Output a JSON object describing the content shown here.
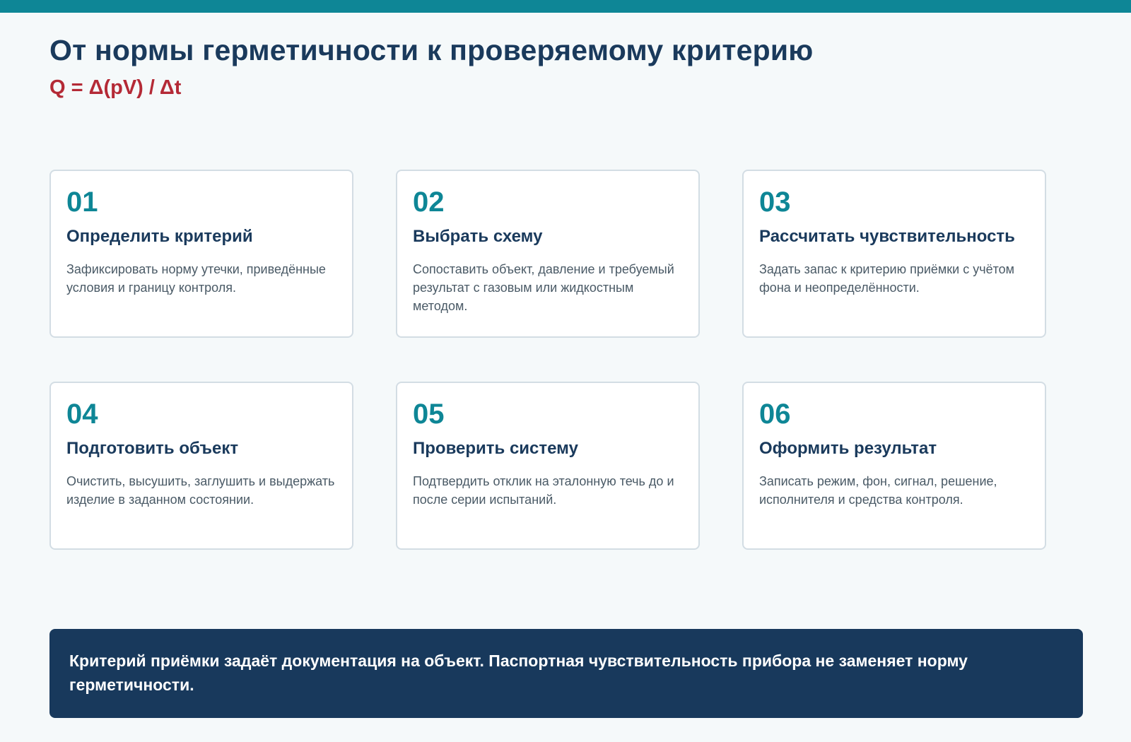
{
  "header": {
    "title": "От нормы герметичности к проверяемому критерию",
    "formula": "Q = Δ(pV) / Δt"
  },
  "steps": [
    {
      "number": "01",
      "title": "Определить критерий",
      "description": "Зафиксировать норму утечки, приведённые условия и границу контроля."
    },
    {
      "number": "02",
      "title": "Выбрать схему",
      "description": "Сопоставить объект, давление и требуемый результат с газовым или жидкостным методом."
    },
    {
      "number": "03",
      "title": "Рассчитать чувствительность",
      "description": "Задать запас к критерию приёмки с учётом фона и неопределённости."
    },
    {
      "number": "04",
      "title": "Подготовить объект",
      "description": "Очистить, высушить, заглушить и выдержать изделие в заданном состоянии."
    },
    {
      "number": "05",
      "title": "Проверить систему",
      "description": "Подтвердить отклик на эталонную течь до и после серии испытаний."
    },
    {
      "number": "06",
      "title": "Оформить результат",
      "description": "Записать режим, фон, сигнал, решение, исполнителя и средства контроля."
    }
  ],
  "note": {
    "text": "Критерий приёмки задаёт документация на объект. Паспортная чувствительность прибора не заменяет норму герметичности."
  },
  "colors": {
    "accent": "#0e8696",
    "heading": "#1a3a5c",
    "formula": "#b42a36",
    "banner": "#18395c"
  }
}
